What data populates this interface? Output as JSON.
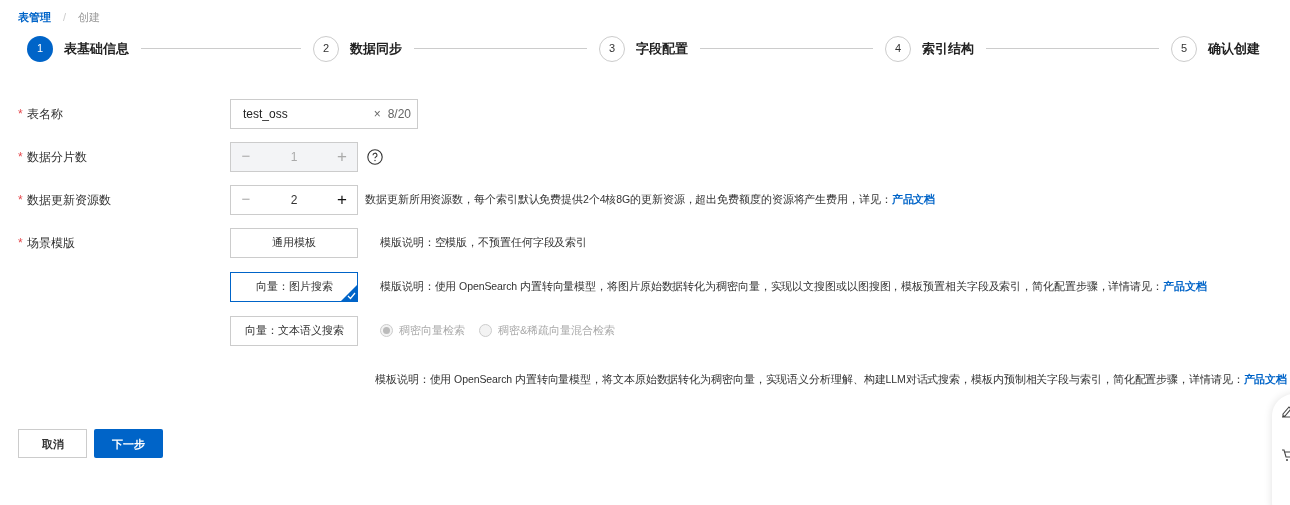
{
  "breadcrumb": [
    {
      "label": "表管理",
      "kind": "link"
    },
    {
      "label": "/",
      "kind": "separator"
    },
    {
      "label": "创建",
      "kind": "current"
    }
  ],
  "steps": [
    {
      "number": "1",
      "label": "表基础信息",
      "selected": true
    },
    {
      "number": "2",
      "label": "数据同步",
      "selected": false
    },
    {
      "number": "3",
      "label": "字段配置",
      "selected": false
    },
    {
      "number": "4",
      "label": "索引结构",
      "selected": false
    },
    {
      "number": "5",
      "label": "确认创建",
      "selected": false
    }
  ],
  "form": {
    "name": {
      "label": "表名称",
      "mark": "*",
      "value": "test_oss",
      "clear": "×",
      "count": "8/20"
    },
    "shards": {
      "label": "数据分片数",
      "mark": "*",
      "value": "1",
      "disabled": true,
      "minus": "−",
      "plus": "+"
    },
    "resources": {
      "label": "数据更新资源数",
      "mark": "*",
      "value": "2",
      "disabled": false,
      "minus": "−",
      "plus": "+",
      "description": "数据更新所用资源数，每个索引默认免费提供2个4核8G的更新资源，超出免费额度的资源将产生费用，详见：",
      "link": "产品文档"
    },
    "templates": {
      "label": "场景模版",
      "mark": "*",
      "options": [
        {
          "label": "通用模板",
          "selected": false,
          "description": "模版说明：空模版，不预置任何字段及索引"
        },
        {
          "label": "向量：图片搜索",
          "selected": true,
          "description": "模版说明：使用 OpenSearch 内置转向量模型，将图片原始数据转化为稠密向量，实现以文搜图或以图搜图，模板预置相关字段及索引，简化配置步骤，详情请见：",
          "link": "产品文档"
        },
        {
          "label": "向量：文本语义搜索",
          "selected": false,
          "modes": [
            {
              "label": "稠密向量检索",
              "selected": true,
              "disabled": true
            },
            {
              "label": "稠密&稀疏向量混合检索",
              "selected": false,
              "disabled": true
            }
          ],
          "description": "模板说明：使用 OpenSearch 内置转向量模型，将文本原始数据转化为稠密向量，实现语义分析理解、构建LLM对话式搜索，模板内预制相关字段与索引，简化配置步骤，详情请见：",
          "link": "产品文档"
        }
      ]
    }
  },
  "actions": [
    {
      "label": "取消",
      "kind": "secondary"
    },
    {
      "label": "下一步",
      "kind": "primary"
    }
  ]
}
